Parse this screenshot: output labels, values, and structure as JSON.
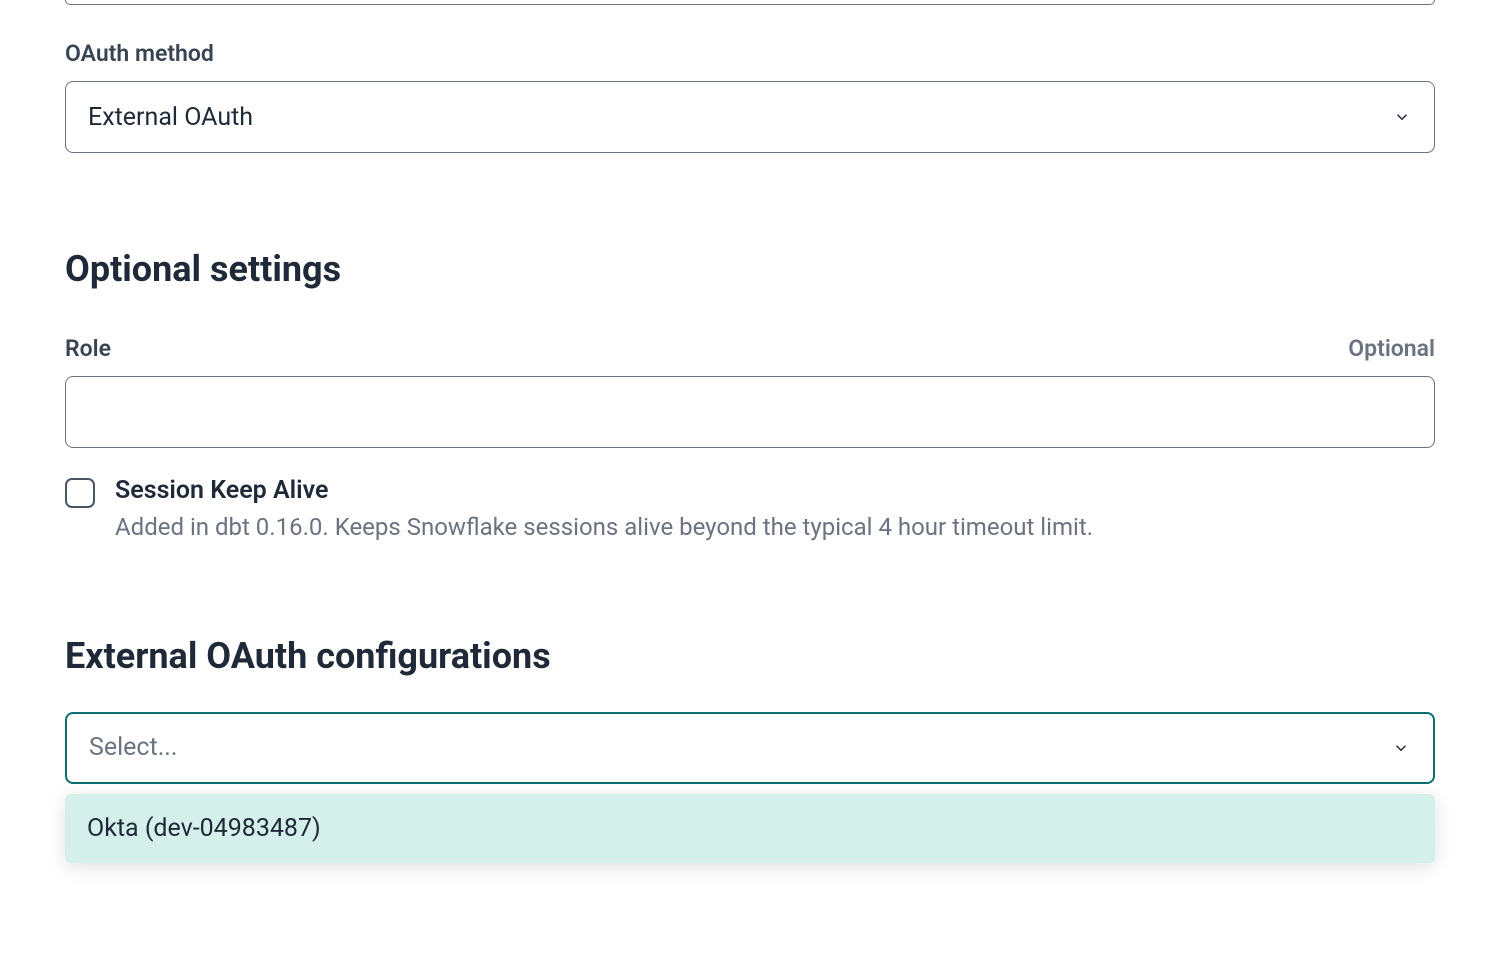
{
  "oauth_method": {
    "label": "OAuth method",
    "value": "External OAuth"
  },
  "optional_settings": {
    "heading": "Optional settings",
    "role": {
      "label": "Role",
      "optional_label": "Optional",
      "value": ""
    },
    "session_keep_alive": {
      "title": "Session Keep Alive",
      "description": "Added in dbt 0.16.0. Keeps Snowflake sessions alive beyond the typical 4 hour timeout limit."
    }
  },
  "external_oauth": {
    "heading": "External OAuth configurations",
    "placeholder": "Select...",
    "option": "Okta (dev-04983487)"
  }
}
